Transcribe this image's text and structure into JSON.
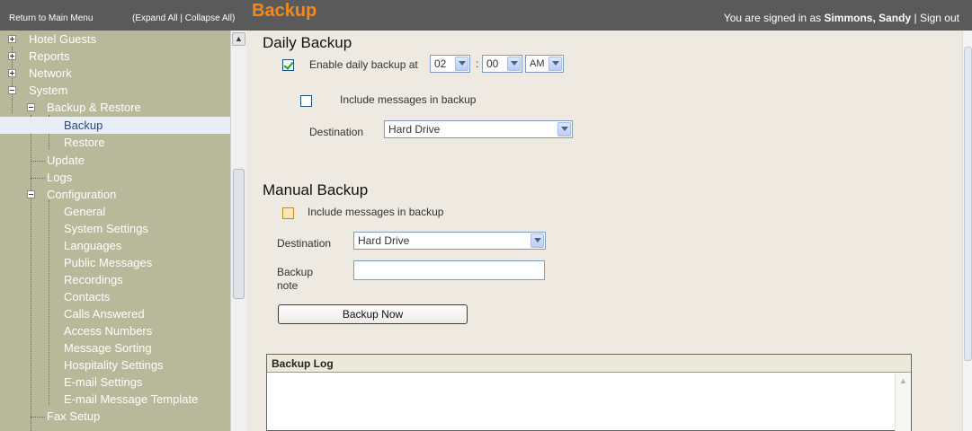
{
  "header": {
    "return_link": "Return to Main Menu",
    "expand_collapse": "(Expand All | Collapse All)",
    "page_title": "Backup",
    "signed_in_prefix": "You are signed in as ",
    "user_name": "Simmons, Sandy",
    "separator": " | ",
    "sign_out": "Sign out"
  },
  "sidebar": {
    "items": [
      {
        "label": "Hotel Guests"
      },
      {
        "label": "Reports"
      },
      {
        "label": "Network"
      },
      {
        "label": "System"
      },
      {
        "label": "Backup & Restore"
      },
      {
        "label": "Backup"
      },
      {
        "label": "Restore"
      },
      {
        "label": "Update"
      },
      {
        "label": "Logs"
      },
      {
        "label": "Configuration"
      },
      {
        "label": "General"
      },
      {
        "label": "System Settings"
      },
      {
        "label": "Languages"
      },
      {
        "label": "Public Messages"
      },
      {
        "label": "Recordings"
      },
      {
        "label": "Contacts"
      },
      {
        "label": "Calls Answered"
      },
      {
        "label": "Access Numbers"
      },
      {
        "label": "Message Sorting"
      },
      {
        "label": "Hospitality Settings"
      },
      {
        "label": "E-mail Settings"
      },
      {
        "label": "E-mail Message Template"
      },
      {
        "label": "Fax Setup"
      }
    ],
    "selected": "Backup"
  },
  "daily": {
    "title": "Daily Backup",
    "enable_checked": true,
    "enable_label": "Enable daily backup at",
    "hour": "02",
    "time_separator": ":",
    "minute": "00",
    "ampm": "AM",
    "include_checked": false,
    "include_label": "Include messages in backup",
    "destination_label": "Destination",
    "destination_value": "Hard Drive"
  },
  "manual": {
    "title": "Manual Backup",
    "include_checked": false,
    "include_label": "Include messages in backup",
    "destination_label": "Destination",
    "destination_value": "Hard Drive",
    "note_label_line1": "Backup",
    "note_label_line2": "note",
    "note_value": "",
    "button_label": "Backup Now"
  },
  "log": {
    "title": "Backup Log"
  },
  "colors": {
    "header_bg": "#5a5a5a",
    "title_accent": "#f5881f",
    "sidebar_bg": "#b8b89a",
    "content_bg": "#eeeae1"
  }
}
